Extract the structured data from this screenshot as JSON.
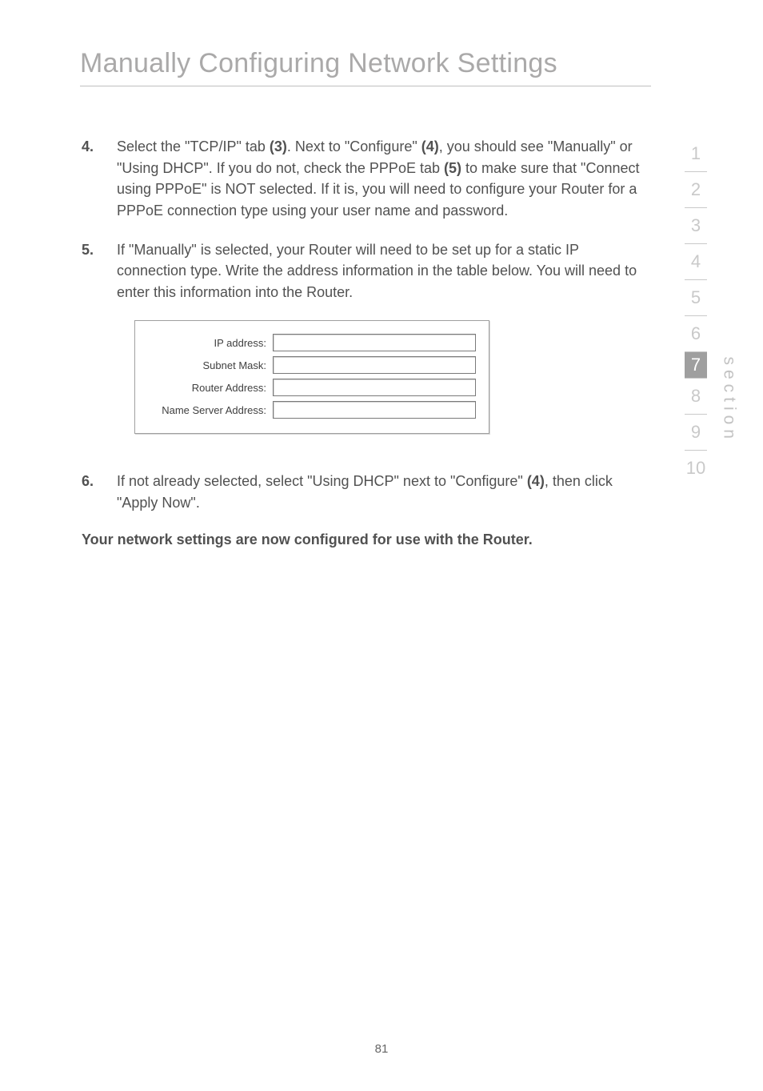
{
  "title": "Manually Configuring Network Settings",
  "steps": {
    "s4": {
      "num": "4.",
      "p1a": "Select the \"TCP/IP\" tab ",
      "b1": "(3)",
      "p1b": ". Next to \"Configure\" ",
      "b2": "(4)",
      "p1c": ", you should see \"Manually\" or \"Using DHCP\". If you do not, check the PPPoE tab ",
      "b3": "(5)",
      "p1d": " to make sure that \"Connect using PPPoE\" is NOT selected. If it is, you will need to configure your Router for a PPPoE connection type using your user name and password."
    },
    "s5": {
      "num": "5.",
      "text": "If \"Manually\" is selected, your Router will need to be set up for a static IP connection type. Write the address information in the table below. You will need to enter this information into the Router."
    },
    "s6": {
      "num": "6.",
      "p1a": "If not already selected, select  \"Using DHCP\" next to \"Configure\" ",
      "b1": "(4)",
      "p1b": ", then click \"Apply Now\"."
    }
  },
  "form": {
    "ip": "IP address:",
    "subnet": "Subnet Mask:",
    "router": "Router Address:",
    "ns": "Name Server Address:"
  },
  "footer": "Your network settings are now configured for use with the Router.",
  "pagenum": "81",
  "sidebar": {
    "n1": "1",
    "n2": "2",
    "n3": "3",
    "n4": "4",
    "n5": "5",
    "n6": "6",
    "n7": "7",
    "n8": "8",
    "n9": "9",
    "n10": "10",
    "label": "section"
  }
}
